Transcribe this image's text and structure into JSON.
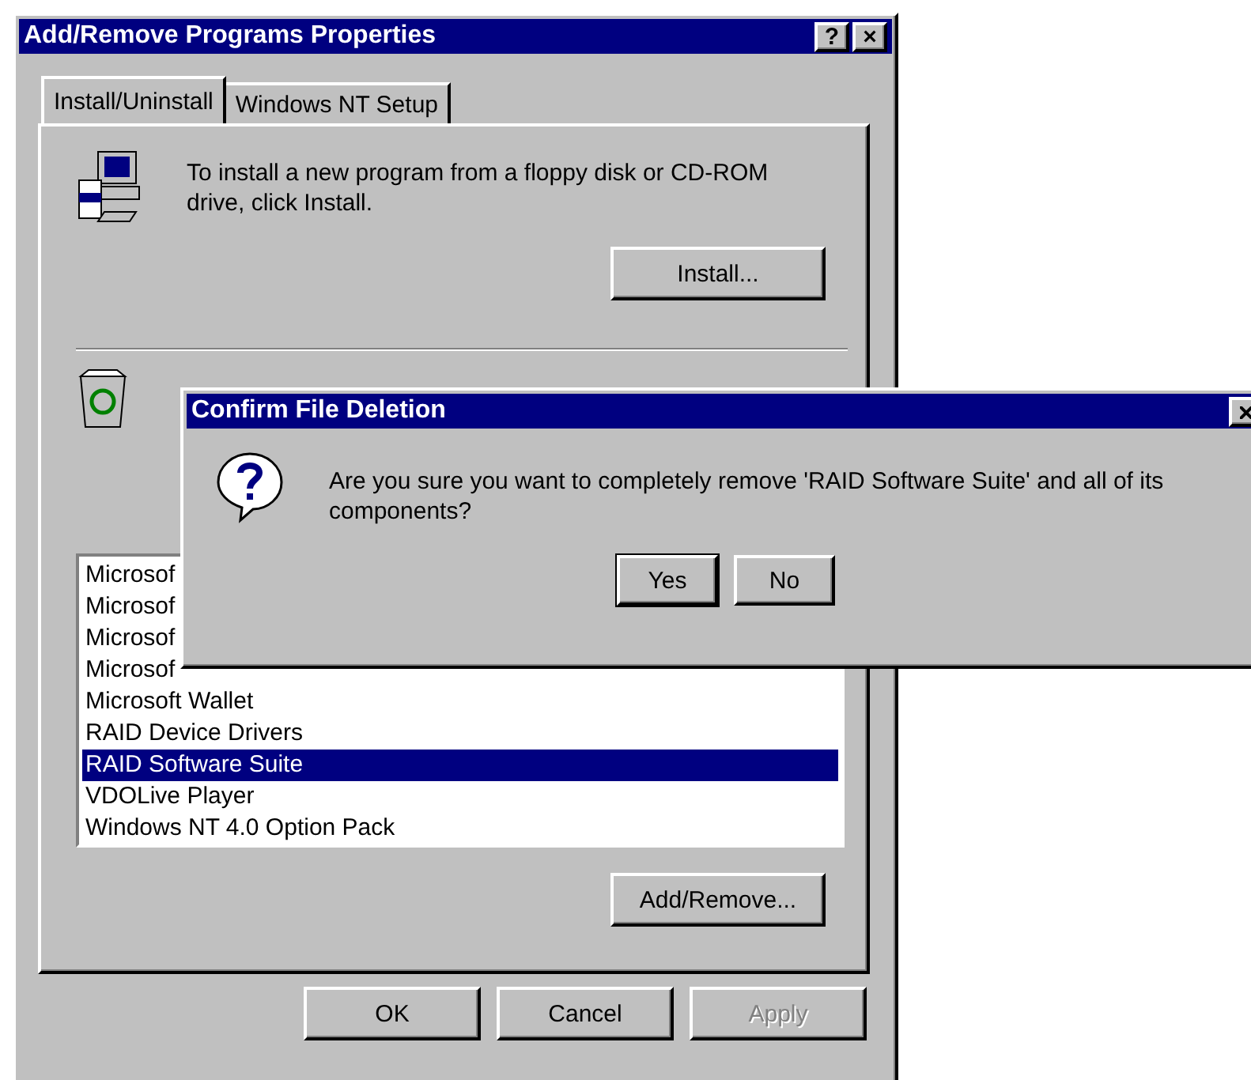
{
  "window": {
    "title": "Add/Remove Programs Properties",
    "help_button": "?",
    "close_button": "×"
  },
  "tabs": [
    {
      "label": "Install/Uninstall",
      "selected": true
    },
    {
      "label": "Windows NT Setup",
      "selected": false
    }
  ],
  "install_section": {
    "text": "To install a new program from a floppy disk or CD-ROM drive, click Install.",
    "button": "Install..."
  },
  "programs": [
    {
      "name": "Microsof",
      "selected": false
    },
    {
      "name": "Microsof",
      "selected": false
    },
    {
      "name": "Microsof",
      "selected": false
    },
    {
      "name": "Microsof",
      "selected": false
    },
    {
      "name": "Microsoft Wallet",
      "selected": false
    },
    {
      "name": "RAID Device Drivers",
      "selected": false
    },
    {
      "name": "RAID Software Suite",
      "selected": true
    },
    {
      "name": "VDOLive Player",
      "selected": false
    },
    {
      "name": "Windows NT 4.0 Option Pack",
      "selected": false
    }
  ],
  "add_remove_button": "Add/Remove...",
  "buttons": [
    {
      "label": "OK",
      "disabled": false
    },
    {
      "label": "Cancel",
      "disabled": false
    },
    {
      "label": "Apply",
      "disabled": true
    }
  ],
  "confirm_dialog": {
    "title": "Confirm File Deletion",
    "message": "Are you sure you want to completely remove 'RAID Software Suite' and all of its components?",
    "buttons": [
      {
        "label": "Yes",
        "default": true
      },
      {
        "label": "No",
        "default": false
      }
    ]
  }
}
